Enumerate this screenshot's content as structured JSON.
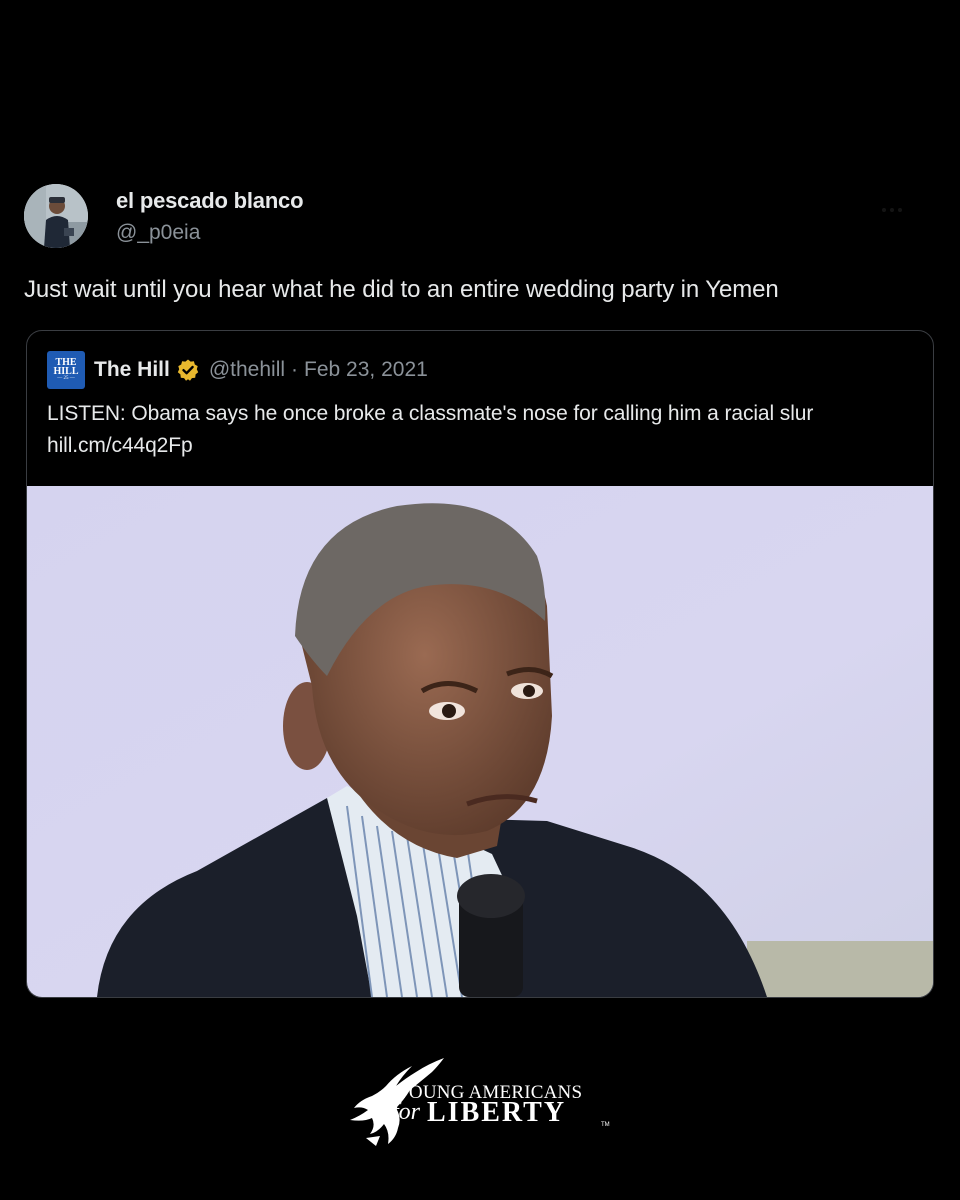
{
  "tweet": {
    "author_name": "el pescado blanco",
    "author_handle": "@_p0eia",
    "avatar_icon": "profile-photo",
    "text": "Just wait until you hear what he did to an entire wedding party in Yemen"
  },
  "quoted_tweet": {
    "logo_icon": "the-hill-logo",
    "logo_line1": "THE",
    "logo_line2": "HILL",
    "logo_line3": "— 25 —",
    "author_name": "The Hill",
    "verified_icon": "verified-gold-badge-icon",
    "handle": "@thehill",
    "separator": "·",
    "date": "Feb 23, 2021",
    "text": "LISTEN: Obama says he once broke a classmate's nose for calling him a racial slur hill.cm/c44q2Fp",
    "media": "photo-man-with-microphone"
  },
  "branding": {
    "logo_icon": "eagle-icon",
    "line1": "YOUNG AMERICANS",
    "for": "for",
    "line2": "LIBERTY",
    "tm": "TM"
  },
  "colors": {
    "background": "#000000",
    "primary_text": "#e7e9ea",
    "secondary_text": "#8b9299",
    "border": "#3a3d42",
    "verified_gold": "#e8b82e",
    "hill_blue": "#1f5bb3"
  }
}
